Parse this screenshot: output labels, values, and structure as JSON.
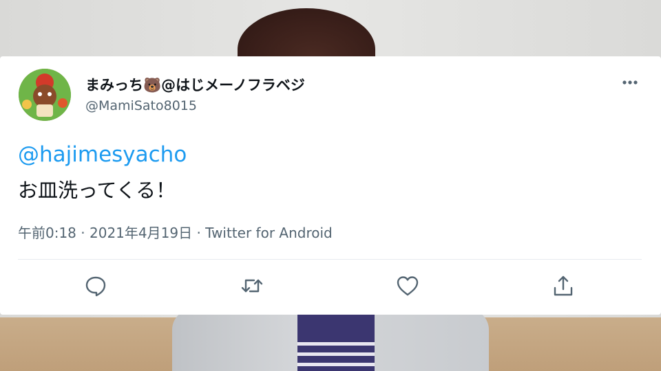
{
  "tweet": {
    "display_name": "まみっち🐻@はじメーノフラベジ",
    "handle": "@MamiSato8015",
    "mention": "@hajimesyacho",
    "text": "お皿洗ってくる！",
    "time": "午前0:18",
    "separator": "·",
    "date": "2021年4月19日",
    "source": "Twitter for Android"
  },
  "icons": {
    "more": "more-horizontal-icon",
    "reply": "reply-icon",
    "retweet": "retweet-icon",
    "like": "heart-icon",
    "share": "share-icon"
  },
  "colors": {
    "mention": "#1d9bf0",
    "text": "#0f1419",
    "secondary": "#536471"
  }
}
